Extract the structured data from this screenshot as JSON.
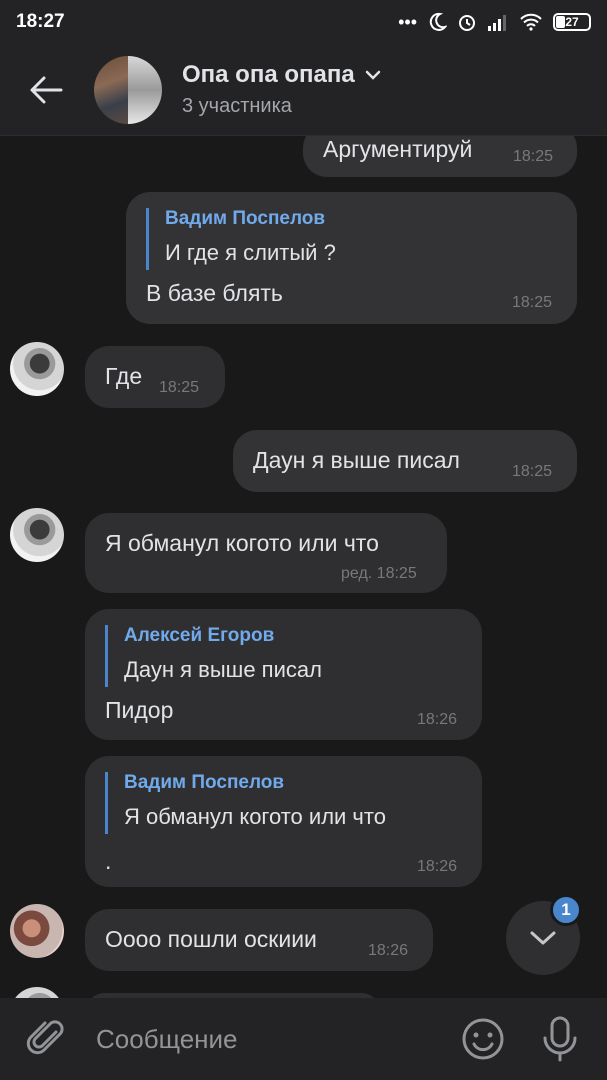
{
  "status_bar": {
    "time": "18:27",
    "battery": "27"
  },
  "header": {
    "title": "Опа опа опапа",
    "subtitle": "3 участника"
  },
  "messages": [
    {
      "id": "m1",
      "direction": "out",
      "text": "Аргументируй",
      "time": "18:25"
    },
    {
      "id": "m2",
      "direction": "out",
      "reply_name": "Вадим Поспелов",
      "reply_text": "И где я слитый ?",
      "text": "В базе блять",
      "time": "18:25"
    },
    {
      "id": "m3",
      "direction": "in",
      "text": "Где",
      "time": "18:25"
    },
    {
      "id": "m4",
      "direction": "out",
      "text": "Даун я выше писал",
      "time": "18:25"
    },
    {
      "id": "m5",
      "direction": "in",
      "text": "Я обманул когото или что",
      "time": "ред. 18:25"
    },
    {
      "id": "m6",
      "direction": "in",
      "reply_name": "Алексей Егоров",
      "reply_text": "Даун я выше писал",
      "text": "Пидор",
      "time": "18:26"
    },
    {
      "id": "m7",
      "direction": "in",
      "reply_name": "Вадим Поспелов",
      "reply_text": "Я обманул когото или что",
      "text": ".",
      "time": "18:26"
    },
    {
      "id": "m8",
      "direction": "in",
      "text": "Оооо пошли оскиии",
      "time": "18:26"
    }
  ],
  "scroll_down": {
    "unread_count": "1"
  },
  "composer": {
    "placeholder": "Сообщение"
  },
  "colors": {
    "background": "#19191a",
    "bar": "#232325",
    "bubble": "#2f2f31",
    "accent": "#4986cc",
    "reply_name": "#71aaeb"
  },
  "icons": [
    "back-arrow-icon",
    "chevron-down-icon",
    "paperclip-icon",
    "emoji-icon",
    "microphone-icon",
    "scroll-down-icon"
  ]
}
